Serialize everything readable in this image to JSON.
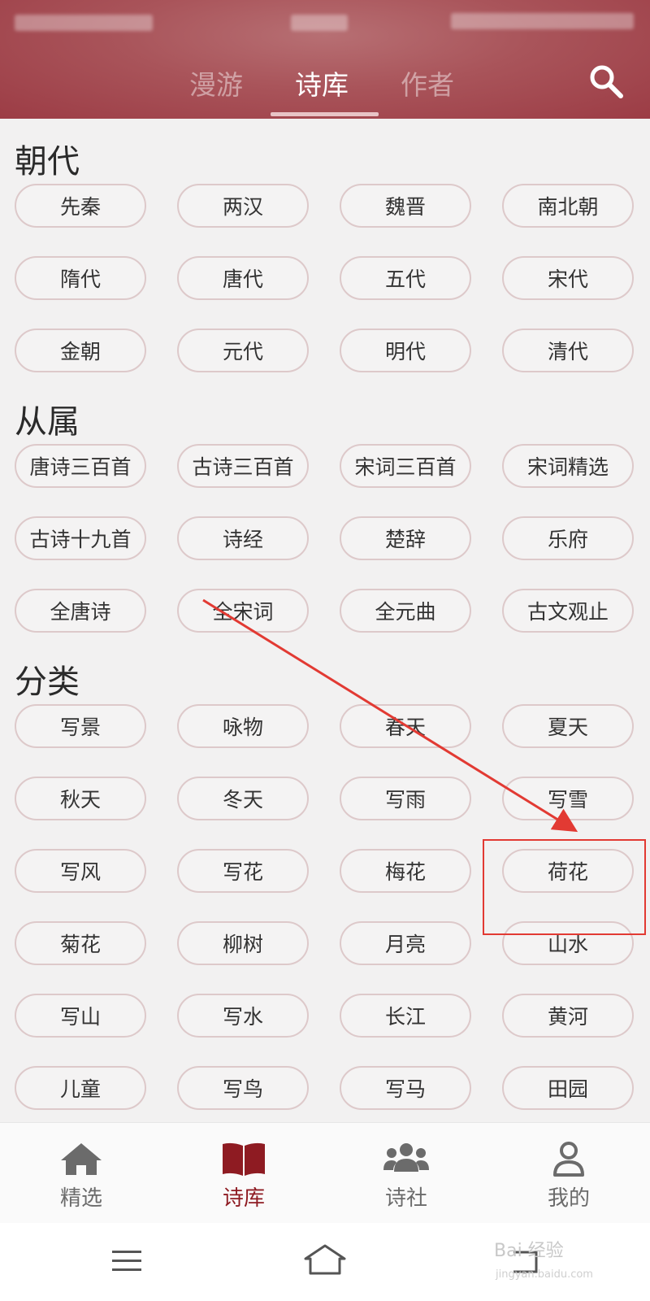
{
  "header": {
    "tabs": [
      {
        "label": "漫游"
      },
      {
        "label": "诗库"
      },
      {
        "label": "作者"
      }
    ]
  },
  "sections": [
    {
      "title": "朝代",
      "chips": [
        "先秦",
        "两汉",
        "魏晋",
        "南北朝",
        "隋代",
        "唐代",
        "五代",
        "宋代",
        "金朝",
        "元代",
        "明代",
        "清代"
      ]
    },
    {
      "title": "从属",
      "chips": [
        "唐诗三百首",
        "古诗三百首",
        "宋词三百首",
        "宋词精选",
        "古诗十九首",
        "诗经",
        "楚辞",
        "乐府",
        "全唐诗",
        "全宋词",
        "全元曲",
        "古文观止"
      ]
    },
    {
      "title": "分类",
      "chips": [
        "写景",
        "咏物",
        "春天",
        "夏天",
        "秋天",
        "冬天",
        "写雨",
        "写雪",
        "写风",
        "写花",
        "梅花",
        "荷花",
        "菊花",
        "柳树",
        "月亮",
        "山水",
        "写山",
        "写水",
        "长江",
        "黄河",
        "儿童",
        "写鸟",
        "写马",
        "田园"
      ]
    }
  ],
  "bottom_nav": [
    {
      "label": "精选",
      "icon": "home-icon"
    },
    {
      "label": "诗库",
      "icon": "book-icon"
    },
    {
      "label": "诗社",
      "icon": "users-icon"
    },
    {
      "label": "我的",
      "icon": "user-icon"
    }
  ],
  "watermark": {
    "text": "Bai 经验",
    "sub": "jingyan.baidu.com"
  },
  "colors": {
    "header": "#a9545a",
    "accent": "#8e1b22",
    "annotation": "#e23a33"
  }
}
